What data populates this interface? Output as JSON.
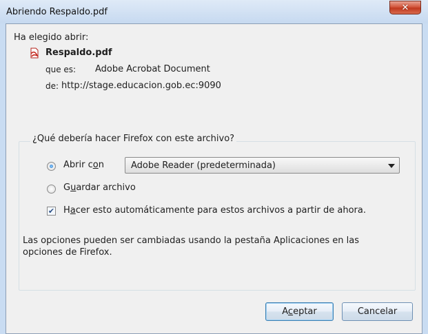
{
  "window": {
    "title": "Abriendo Respaldo.pdf"
  },
  "intro": "Ha elegido abrir:",
  "file": {
    "icon": "pdf-icon",
    "name": "Respaldo.pdf",
    "type_label": "que es:",
    "type_value": "Adobe Acrobat Document",
    "from_label": "de:",
    "from_value": "http://stage.educacion.gob.ec:9090"
  },
  "action_group": {
    "legend": "¿Qué debería hacer Firefox con este archivo?",
    "open_with": {
      "label_pre": "Abrir c",
      "label_u": "o",
      "label_post": "n",
      "selected": true
    },
    "app_select": {
      "value": "Adobe Reader  (predeterminada)"
    },
    "save_file": {
      "label_pre": "G",
      "label_u": "u",
      "label_post": "ardar archivo",
      "selected": false
    },
    "auto": {
      "label_pre": "H",
      "label_u": "a",
      "label_post": "cer esto automáticamente para estos archivos a partir de ahora.",
      "checked": true
    },
    "note_line1": "Las opciones pueden ser cambiadas usando la pestaña Aplicaciones en las",
    "note_line2": "opciones de Firefox."
  },
  "buttons": {
    "ok_pre": "A",
    "ok_u": "c",
    "ok_post": "eptar",
    "cancel": "Cancelar"
  },
  "colors": {
    "title_bar": "#c6d9f0",
    "close_button": "#c0391f",
    "dialog_bg": "#f0f0f0"
  }
}
